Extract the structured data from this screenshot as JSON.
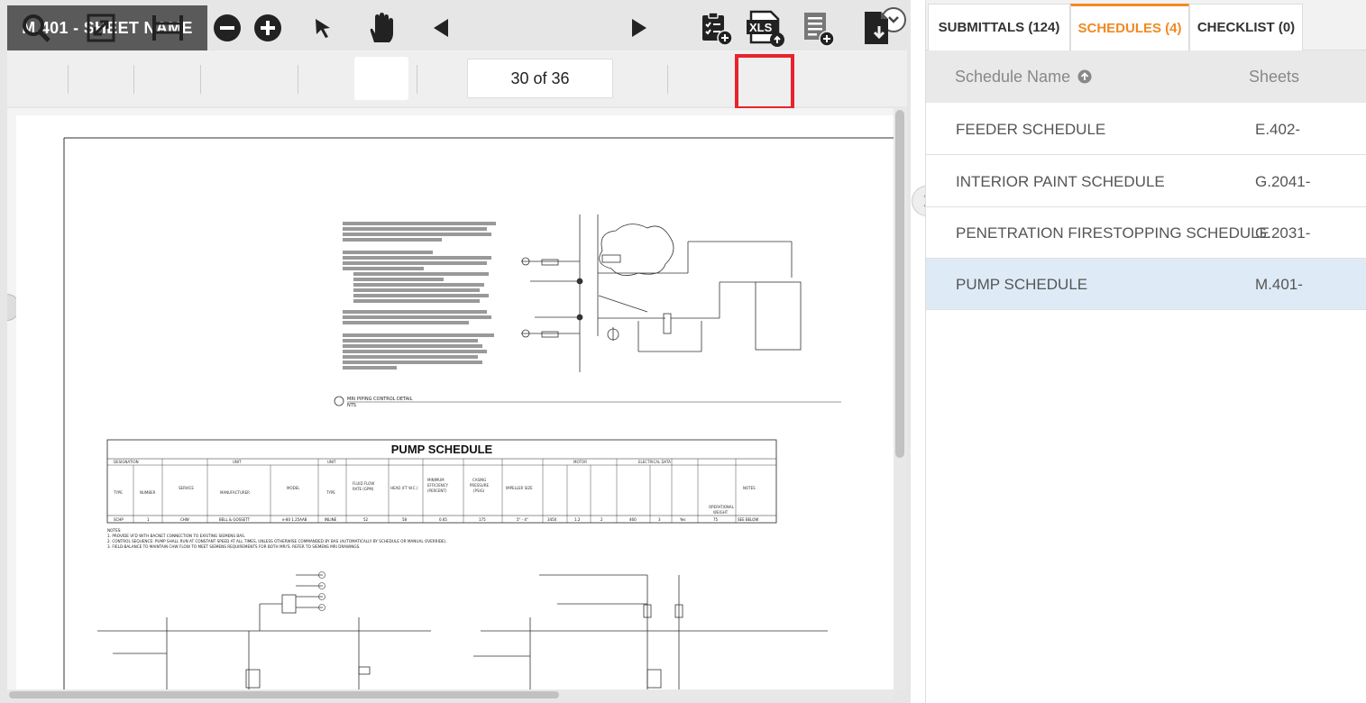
{
  "viewer": {
    "sheet_tab": "M.401 - SHEET NAME",
    "page_indicator": "30 of 36"
  },
  "drawing": {
    "detail_title": "MRI PIPING CONTROL DETAIL",
    "detail_sub": "NTS",
    "schedule_title": "PUMP SCHEDULE",
    "notes_label": "NOTES:",
    "note1": "1. PROVIDE VFD WITH BACNET CONNECTION TO EXISTING SIEMENS BAS.",
    "note2": "2. CONTROL SEQUENCE: PUMP SHALL RUN AT CONSTANT SPEED AT ALL TIMES, UNLESS OTHERWISE COMMANDED BY BAS (AUTOMATICALLY BY SCHEDULE OR MANUAL OVERRIDE).",
    "note3": "3. FIELD-BALANCE TO MAINTAIN CHW FLOW TO MEET SIEMENS REQUIREMENTS FOR BOTH MRI'S. REFER TO SIEMENS MRI DRAWINGS.",
    "row": [
      "SCHP",
      "1",
      "CHW",
      "BELL & GOSSETT",
      "e-80 1.25AAB",
      "INLINE",
      "52",
      "58",
      "0.65",
      "175",
      "5\" - 4\"",
      "3450",
      "1.2",
      "2",
      "460",
      "3",
      "Yes",
      "75",
      "SEE BELOW"
    ]
  },
  "panel": {
    "tabs": [
      "SUBMITTALS (124)",
      "SCHEDULES (4)",
      "CHECKLIST (0)"
    ],
    "col_name": "Schedule Name",
    "col_sheets": "Sheets",
    "rows": [
      {
        "name": "FEEDER SCHEDULE",
        "sheet": "E.402-"
      },
      {
        "name": "INTERIOR PAINT SCHEDULE",
        "sheet": "G.2041-"
      },
      {
        "name": "PENETRATION FIRESTOPPING SCHEDULE",
        "sheet": "G.2031-"
      },
      {
        "name": "PUMP SCHEDULE",
        "sheet": "M.401-"
      }
    ]
  },
  "colors": {
    "accent": "#f08a24",
    "highlight": "#e8232d",
    "selected_row": "#deebf7"
  }
}
